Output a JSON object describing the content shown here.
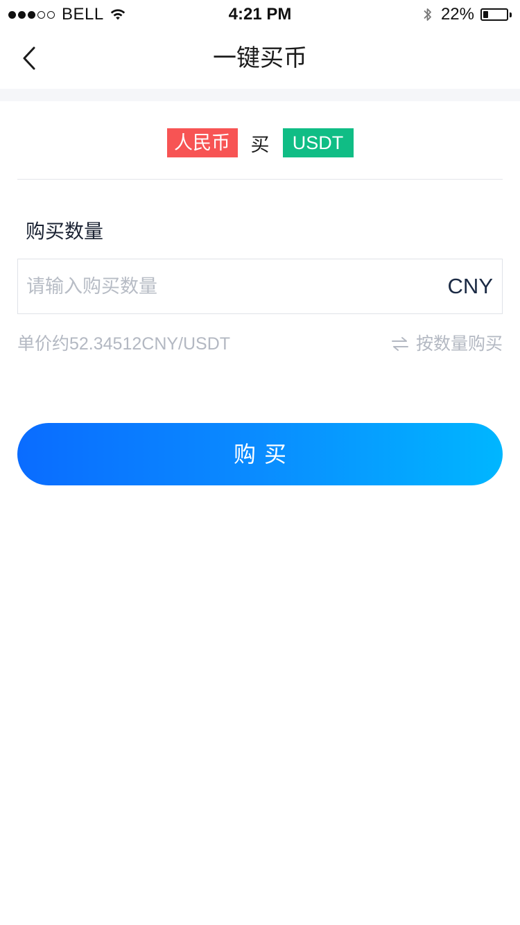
{
  "status_bar": {
    "carrier": "BELL",
    "time": "4:21 PM",
    "battery_percent_text": "22%",
    "battery_level": 0.22,
    "signal_bars_filled": 3,
    "signal_bars_total": 5
  },
  "nav": {
    "title": "一键买币",
    "back_icon": "chevron-left-icon"
  },
  "pair": {
    "from_currency": "人民币",
    "action": "买",
    "to_currency": "USDT",
    "from_color": "#f75454",
    "to_color": "#10bd85"
  },
  "form": {
    "quantity_label": "购买数量",
    "input_placeholder": "请输入购买数量",
    "input_value": "",
    "unit": "CNY",
    "unit_price_text": "单价约52.34512CNY/USDT",
    "switch_mode_label": "按数量购买",
    "switch_icon": "swap-arrows-icon"
  },
  "actions": {
    "buy_label": "购买",
    "buy_gradient_start": "#0a6cff",
    "buy_gradient_end": "#00b6ff"
  }
}
